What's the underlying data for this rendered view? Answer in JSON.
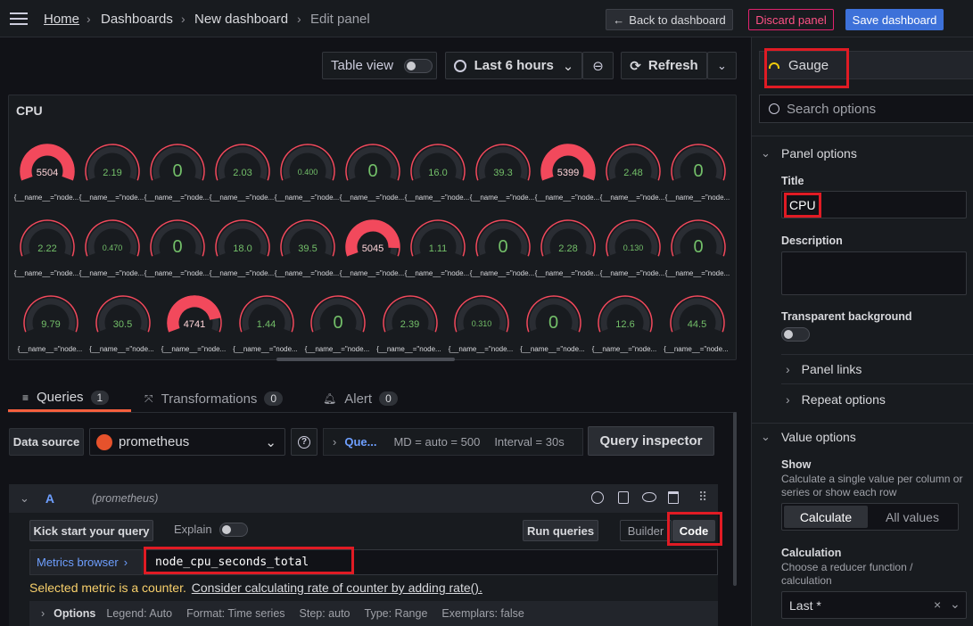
{
  "breadcrumb": {
    "home": "Home",
    "dashboards": "Dashboards",
    "new_dashboard": "New dashboard",
    "current": "Edit panel"
  },
  "header": {
    "back": "Back to dashboard",
    "discard": "Discard panel",
    "save": "Save dashboard"
  },
  "toolbar": {
    "table_view": "Table view",
    "time_range": "Last 6 hours",
    "refresh": "Refresh"
  },
  "panel": {
    "title": "CPU"
  },
  "gauges": [
    {
      "value": "5504",
      "label": "{__name__=\"node...",
      "fill": 1.0,
      "red": true
    },
    {
      "value": "2.19",
      "label": "{__name__=\"node...",
      "fill": 0.0,
      "red": false
    },
    {
      "value": "0",
      "label": "{__name__=\"node...",
      "fill": 0.0,
      "red": false,
      "big": true
    },
    {
      "value": "2.03",
      "label": "{__name__=\"node...",
      "fill": 0.0,
      "red": false
    },
    {
      "value": "0.400",
      "label": "{__name__=\"node...",
      "fill": 0.0,
      "red": false
    },
    {
      "value": "0",
      "label": "{__name__=\"node...",
      "fill": 0.0,
      "red": false,
      "big": true
    },
    {
      "value": "16.0",
      "label": "{__name__=\"node...",
      "fill": 0.0,
      "red": false
    },
    {
      "value": "39.3",
      "label": "{__name__=\"node...",
      "fill": 0.0,
      "red": false
    },
    {
      "value": "5399",
      "label": "{__name__=\"node...",
      "fill": 1.0,
      "red": true
    },
    {
      "value": "2.48",
      "label": "{__name__=\"node...",
      "fill": 0.0,
      "red": false
    },
    {
      "value": "0",
      "label": "{__name__=\"node...",
      "fill": 0.0,
      "red": false,
      "big": true
    },
    {
      "value": "2.22",
      "label": "{__name__=\"node...",
      "fill": 0.0,
      "red": false
    },
    {
      "value": "0.470",
      "label": "{__name__=\"node...",
      "fill": 0.0,
      "red": false
    },
    {
      "value": "0",
      "label": "{__name__=\"node...",
      "fill": 0.0,
      "red": false,
      "big": true
    },
    {
      "value": "18.0",
      "label": "{__name__=\"node...",
      "fill": 0.0,
      "red": false
    },
    {
      "value": "39.5",
      "label": "{__name__=\"node...",
      "fill": 0.0,
      "red": false
    },
    {
      "value": "5045",
      "label": "{__name__=\"node...",
      "fill": 0.92,
      "red": true
    },
    {
      "value": "1.11",
      "label": "{__name__=\"node...",
      "fill": 0.0,
      "red": false
    },
    {
      "value": "0",
      "label": "{__name__=\"node...",
      "fill": 0.0,
      "red": false,
      "big": true
    },
    {
      "value": "2.28",
      "label": "{__name__=\"node...",
      "fill": 0.0,
      "red": false
    },
    {
      "value": "0.130",
      "label": "{__name__=\"node...",
      "fill": 0.0,
      "red": false
    },
    {
      "value": "0",
      "label": "{__name__=\"node...",
      "fill": 0.0,
      "red": false,
      "big": true
    },
    {
      "value": "9.79",
      "label": "{__name__=\"node...",
      "fill": 0.0,
      "red": false
    },
    {
      "value": "30.5",
      "label": "{__name__=\"node...",
      "fill": 0.0,
      "red": false
    },
    {
      "value": "4741",
      "label": "{__name__=\"node...",
      "fill": 0.86,
      "red": true
    },
    {
      "value": "1.44",
      "label": "{__name__=\"node...",
      "fill": 0.0,
      "red": false
    },
    {
      "value": "0",
      "label": "{__name__=\"node...",
      "fill": 0.0,
      "red": false,
      "big": true
    },
    {
      "value": "2.39",
      "label": "{__name__=\"node...",
      "fill": 0.0,
      "red": false
    },
    {
      "value": "0.310",
      "label": "{__name__=\"node...",
      "fill": 0.0,
      "red": false
    },
    {
      "value": "0",
      "label": "{__name__=\"node...",
      "fill": 0.0,
      "red": false,
      "big": true
    },
    {
      "value": "12.6",
      "label": "{__name__=\"node...",
      "fill": 0.0,
      "red": false
    },
    {
      "value": "44.5",
      "label": "{__name__=\"node...",
      "fill": 0.0,
      "red": false
    }
  ],
  "tabs": {
    "queries": "Queries",
    "queries_count": "1",
    "transformations": "Transformations",
    "transformations_count": "0",
    "alert": "Alert",
    "alert_count": "0"
  },
  "datasource": {
    "label": "Data source",
    "value": "prometheus",
    "help": "?",
    "query_options": "Que...",
    "md": "MD = auto = 500",
    "interval": "Interval = 30s",
    "inspector": "Query inspector"
  },
  "query": {
    "ref": "A",
    "ds": "(prometheus)",
    "kickstart": "Kick start your query",
    "explain": "Explain",
    "run": "Run queries",
    "builder": "Builder",
    "code": "Code",
    "metrics_browser": "Metrics browser",
    "expr": "node_cpu_seconds_total",
    "warning": "Selected metric is a counter.",
    "warning_link": "Consider calculating rate of counter by adding rate().",
    "options_label": "Options",
    "legend": "Legend: Auto",
    "format": "Format: Time series",
    "step": "Step: auto",
    "type": "Type: Range",
    "exemplars": "Exemplars: false"
  },
  "options": {
    "viz": "Gauge",
    "search_placeholder": "Search options",
    "panel_options": "Panel options",
    "title_label": "Title",
    "title_value": "CPU",
    "description_label": "Description",
    "transparent_label": "Transparent background",
    "panel_links": "Panel links",
    "repeat_options": "Repeat options",
    "value_options": "Value options",
    "show_label": "Show",
    "show_desc": "Calculate a single value per column or series or show each row",
    "calculate": "Calculate",
    "all_values": "All values",
    "calculation_label": "Calculation",
    "calculation_desc": "Choose a reducer function / calculation",
    "calculation_value": "Last *"
  },
  "colors": {
    "red": "#f2495c",
    "green": "#73bf69",
    "blue": "#3d71d9",
    "highlight": "#e01b24"
  }
}
